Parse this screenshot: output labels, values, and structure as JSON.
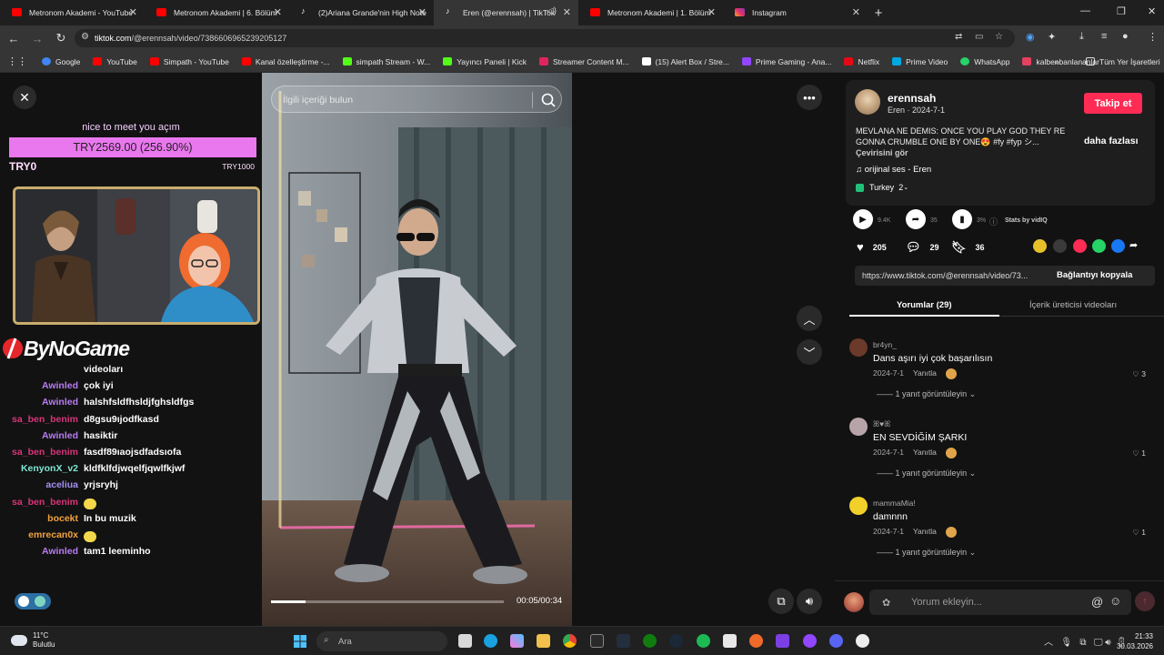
{
  "browser": {
    "tabs": [
      {
        "title": "Metronom Akademi - YouTube",
        "color": "#ff0000"
      },
      {
        "title": "Metronom Akademi | 6. Bölüm",
        "color": "#ff0000"
      },
      {
        "title": "(2)Ariana Grande'nin High Note",
        "color": "#ffffff"
      },
      {
        "title": "Eren (@erennsah) | TikTok",
        "color": "#ffffff"
      },
      {
        "title": "Metronom Akademi | 1. Bölüm",
        "color": "#ff0000"
      },
      {
        "title": "Instagram",
        "color": "#e1306c"
      }
    ],
    "url_host": "tiktok.com",
    "url_path": "/@erennsah/video/7386606965239205127",
    "bookmarks": [
      {
        "label": "Google",
        "color": "#4285f4"
      },
      {
        "label": "YouTube",
        "color": "#ff0000"
      },
      {
        "label": "Simpath - YouTube",
        "color": "#ff0000"
      },
      {
        "label": "Kanal özelleştirme -...",
        "color": "#ff0000"
      },
      {
        "label": "simpath Stream - W...",
        "color": "#53fc18"
      },
      {
        "label": "Yayıncı Paneli | Kick",
        "color": "#53fc18"
      },
      {
        "label": "Streamer Content M...",
        "color": "#e0245e"
      },
      {
        "label": "(15) Alert Box / Stre...",
        "color": "#ffffff"
      },
      {
        "label": "Prime Gaming - Ana...",
        "color": "#9146ff"
      },
      {
        "label": "Netflix",
        "color": "#e50914"
      },
      {
        "label": "Prime Video",
        "color": "#00a8e1"
      },
      {
        "label": "WhatsApp",
        "color": "#25d366"
      },
      {
        "label": "kalbenbanlananlar",
        "color": "#e4405f"
      }
    ],
    "all_bookmarks": "Tüm Yer İşaretleri"
  },
  "overlay": {
    "donation_message": "nice to meet you açım",
    "donation_amount": "TRY2569.00 (256.90%)",
    "goal_start": "TRY0",
    "goal_end": "TRY1000",
    "brand": "ByNoGame",
    "chat": [
      {
        "user": "",
        "text": "videoları",
        "color": "#ffffff"
      },
      {
        "user": "Awinled",
        "text": "çok iyi",
        "color": "#b87cf2"
      },
      {
        "user": "Awinled",
        "text": "halshfsldfhsldjfghsldfgs",
        "color": "#b87cf2"
      },
      {
        "user": "sa_ben_benim",
        "text": "d8gsu9ıjodfkasd",
        "color": "#d8347a"
      },
      {
        "user": "Awinled",
        "text": "hasiktir",
        "color": "#b87cf2"
      },
      {
        "user": "sa_ben_benim",
        "text": "fasdf89ıaojsdfadsıofa",
        "color": "#d8347a"
      },
      {
        "user": "KenyonX_v2",
        "text": "kldfklfdjwqelfjqwlfkjwf",
        "color": "#7ee6d2"
      },
      {
        "user": "aceliua",
        "text": "yrjsryhj",
        "color": "#a590f2"
      },
      {
        "user": "sa_ben_benim",
        "text": "",
        "color": "#d8347a"
      },
      {
        "user": "bocekt",
        "text": "In bu muzik",
        "color": "#f2a23c"
      },
      {
        "user": "emrecan0x",
        "text": "",
        "color": "#f2a23c"
      },
      {
        "user": "Awinled",
        "text": "tam1 leeminho",
        "color": "#b87cf2"
      }
    ]
  },
  "video": {
    "search_placeholder": "İlgili içeriği bulun",
    "time": "00:05/00:34",
    "progress": 0.15
  },
  "post": {
    "username": "erennsah",
    "subtitle": "Eren · 2024-7-1",
    "follow_label": "Takip et",
    "description": "MEVLANA NE DEMIS: ONCE YOU PLAY GOD THEY RE GONNA CRUMBLE ONE BY ONE😍 #fy #fyp シ...",
    "translate_label": "Çevirisini gör",
    "more_label": "daha fazlası",
    "sound": "orijinal ses - Eren",
    "region": "Turkey",
    "region_count": "2",
    "stats": {
      "views": "9.4K",
      "shares": "35",
      "rate": "3%",
      "stats_label": "Stats by vidIQ"
    },
    "likes": "205",
    "comments": "29",
    "saves": "36",
    "link": "https://www.tiktok.com/@erennsah/video/73...",
    "copy_label": "Bağlantıyı kopyala",
    "tab_comments": "Yorumlar (29)",
    "tab_creator": "İçerik üreticisi videoları"
  },
  "comments": [
    {
      "user": "br4yn_",
      "text": "Dans aşırı iyi çok başarılısın",
      "date": "2024-7-1",
      "reply": "Yanıtla",
      "likes": "3",
      "replies": "1 yanıt görüntüleyin"
    },
    {
      "user": "ꕤ♥ꕤ",
      "text": "EN SEVDİĞİM ŞARKI",
      "date": "2024-7-1",
      "reply": "Yanıtla",
      "likes": "1",
      "replies": "1 yanıt görüntüleyin"
    },
    {
      "user": "mammaMia!",
      "text": "damnnn",
      "date": "2024-7-1",
      "reply": "Yanıtla",
      "likes": "1",
      "replies": "1 yanıt görüntüleyin"
    }
  ],
  "comment_input_placeholder": "Yorum ekleyin...",
  "taskbar": {
    "temp": "11°C",
    "weather": "Bulutlu",
    "search": "Ara",
    "time": "21:33",
    "date": "30.03.2026"
  }
}
